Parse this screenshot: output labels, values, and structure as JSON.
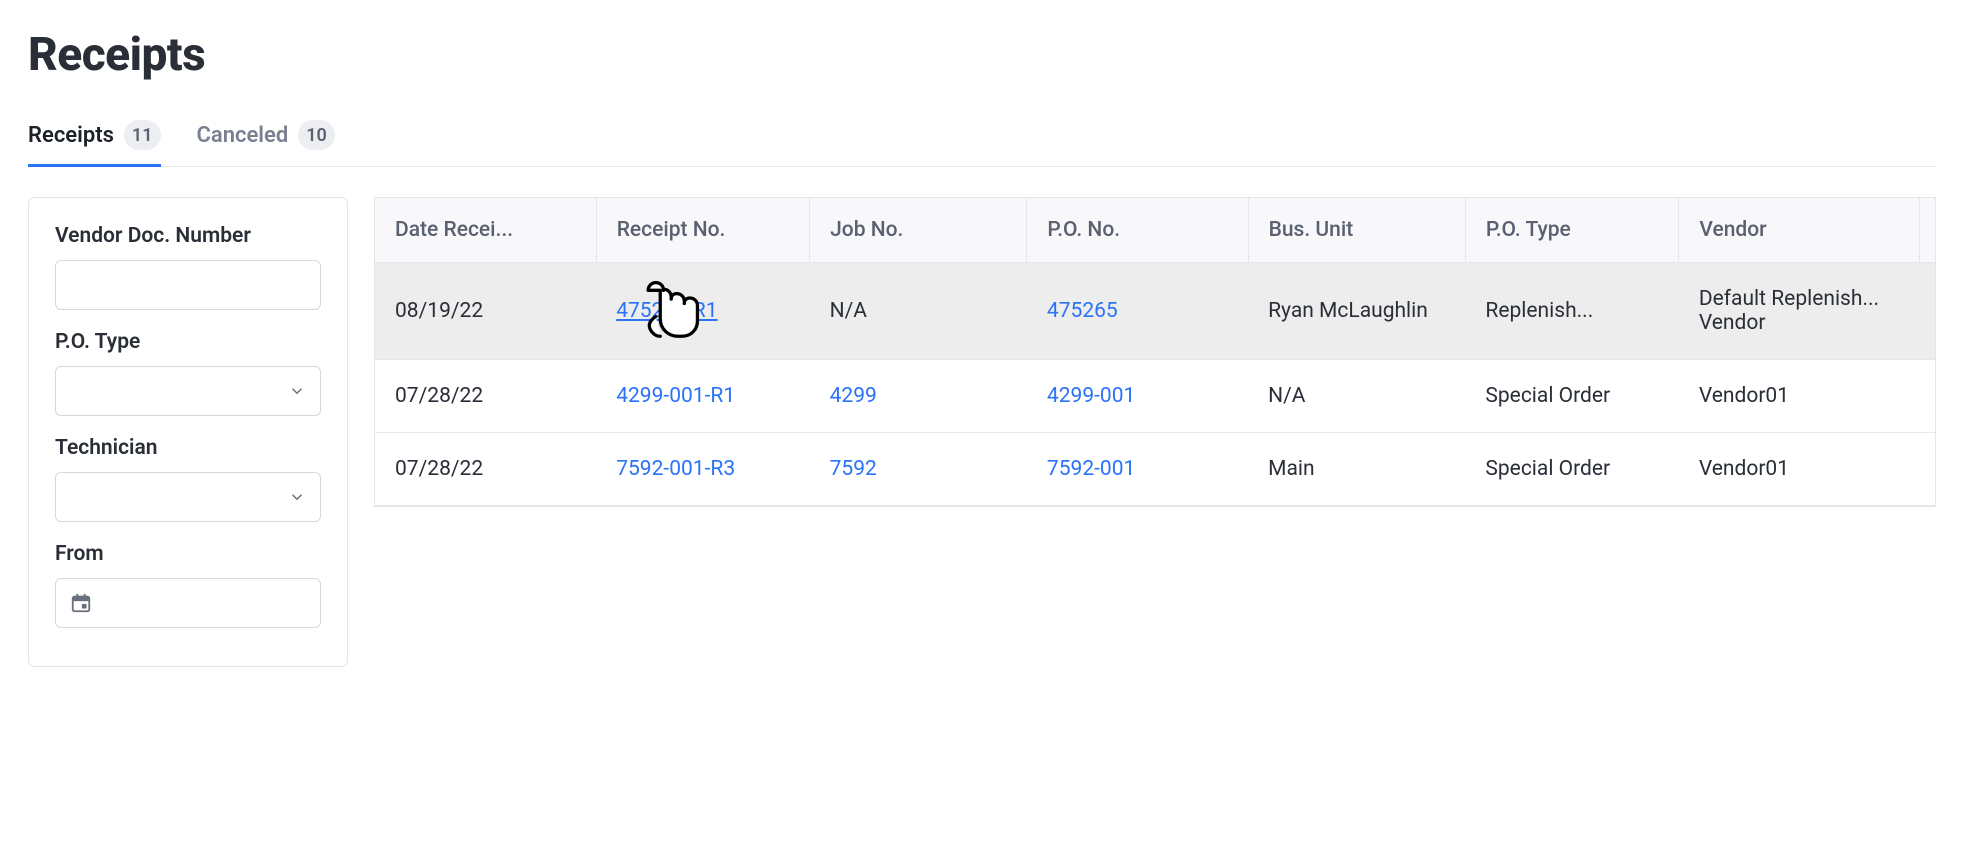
{
  "title": "Receipts",
  "tabs": [
    {
      "label": "Receipts",
      "count": "11",
      "active": true
    },
    {
      "label": "Canceled",
      "count": "10",
      "active": false
    }
  ],
  "filters": {
    "vendor_doc_number": {
      "label": "Vendor Doc. Number",
      "value": ""
    },
    "po_type": {
      "label": "P.O. Type",
      "value": ""
    },
    "technician": {
      "label": "Technician",
      "value": ""
    },
    "from": {
      "label": "From",
      "value": ""
    }
  },
  "columns": {
    "date_received": "Date Recei...",
    "receipt_no": "Receipt No.",
    "job_no": "Job No.",
    "po_no": "P.O. No.",
    "bus_unit": "Bus. Unit",
    "po_type": "P.O. Type",
    "vendor": "Vendor"
  },
  "rows": [
    {
      "date_received": "08/19/22",
      "receipt_no": "475265-R1",
      "job_no": "N/A",
      "po_no": "475265",
      "bus_unit": "Ryan McLaughlin",
      "po_type": "Replenish...",
      "vendor": "Default Replenish... Vendor",
      "hovered": true
    },
    {
      "date_received": "07/28/22",
      "receipt_no": "4299-001-R1",
      "job_no": "4299",
      "po_no": "4299-001",
      "bus_unit": "N/A",
      "po_type": "Special Order",
      "vendor": "Vendor01",
      "hovered": false
    },
    {
      "date_received": "07/28/22",
      "receipt_no": "7592-001-R3",
      "job_no": "7592",
      "po_no": "7592-001",
      "bus_unit": "Main",
      "po_type": "Special Order",
      "vendor": "Vendor01",
      "hovered": false
    }
  ],
  "icons": {
    "chevron_down": "chevron-down-icon",
    "calendar": "calendar-icon",
    "pointer": "pointer-cursor-icon"
  }
}
